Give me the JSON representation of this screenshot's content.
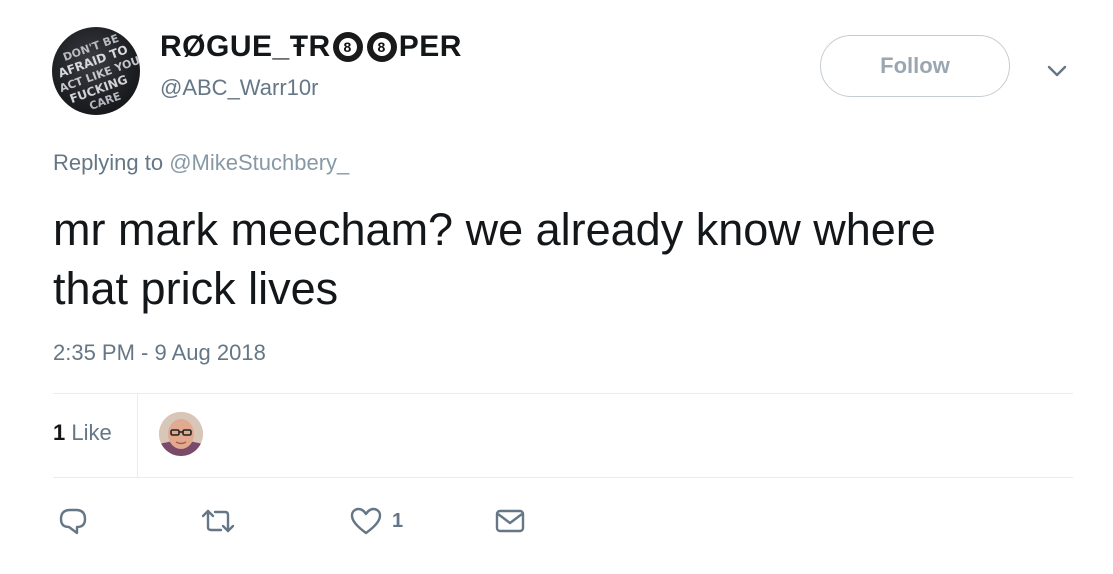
{
  "user": {
    "display_name_part1": "RØGUE_ŦR",
    "eightball_1": "8",
    "eightball_2": "8",
    "display_name_part2": "PER",
    "handle": "@ABC_Warr10r",
    "avatar_lines": [
      "DON'T BE",
      "AFRAID TO",
      "ACT LIKE YOU",
      "FUCKING",
      "CARE"
    ]
  },
  "actions_top": {
    "follow_label": "Follow",
    "menu_icon": "chevron-down-icon"
  },
  "reply": {
    "prefix": "Replying to",
    "mention": "@MikeStuchbery_"
  },
  "tweet": {
    "text_line1": "mr mark meecham? we already know where",
    "text_line2": "that prick lives",
    "timestamp": "2:35 PM - 9 Aug 2018"
  },
  "stats": {
    "like_count": "1",
    "like_label": "Like"
  },
  "action_bar": {
    "reply_icon": "reply-icon",
    "retweet_icon": "retweet-icon",
    "like_icon": "heart-icon",
    "like_count": "1",
    "dm_icon": "envelope-icon"
  },
  "colors": {
    "text": "#14171a",
    "secondary": "#657786",
    "border": "#e6ecf0",
    "follow_text": "#9aa7b1"
  }
}
